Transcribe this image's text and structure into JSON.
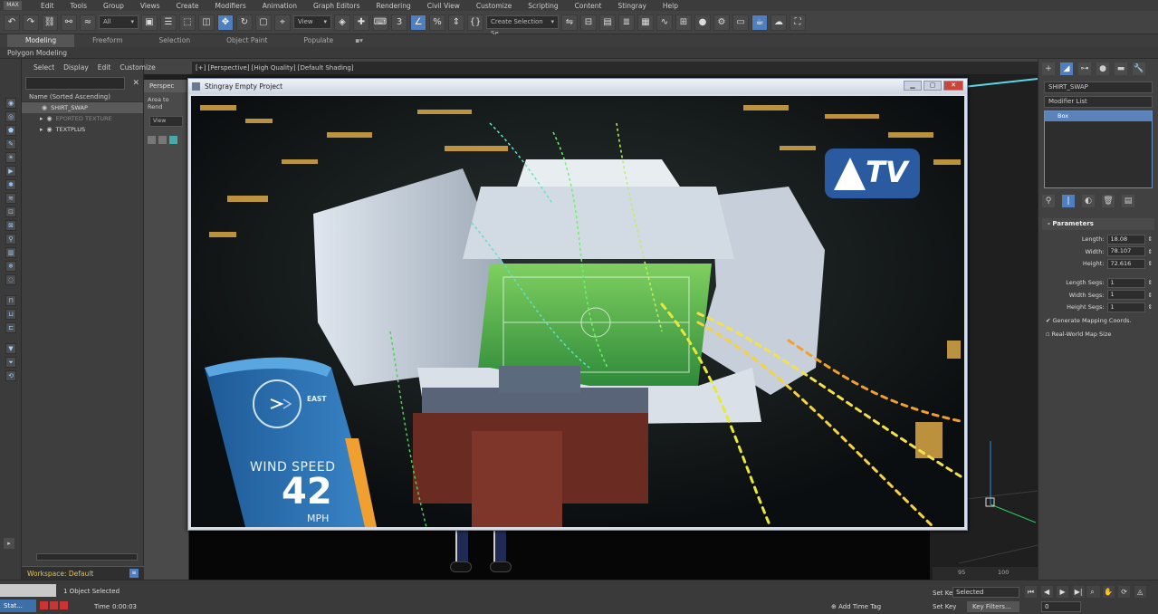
{
  "menu": [
    "Edit",
    "Tools",
    "Group",
    "Views",
    "Create",
    "Modifiers",
    "Animation",
    "Graph Editors",
    "Rendering",
    "Civil View",
    "Customize",
    "Scripting",
    "Content",
    "Stingray",
    "Help"
  ],
  "toolbar": {
    "filter_value": "All",
    "view_value": "View",
    "selection_set_placeholder": "Create Selection Se"
  },
  "ribbon": {
    "tabs": [
      "Modeling",
      "Freeform",
      "Selection",
      "Object Paint",
      "Populate"
    ],
    "active": "Modeling",
    "subtitle": "Polygon Modeling"
  },
  "explorer": {
    "menu": [
      "Select",
      "Display",
      "Edit",
      "Customize"
    ],
    "column_header": "Name (Sorted Ascending)",
    "items": [
      {
        "label": "SHIRT_SWAP"
      },
      {
        "label": "EPORTED TEXTURE"
      },
      {
        "label": "TEXTPLUS"
      }
    ],
    "workspace": "Workspace: Default"
  },
  "viewport": {
    "label": "[+] [Perspective] [High Quality] [Default Shading]"
  },
  "perspective_panel": {
    "title": "Perspec",
    "area": "Area to Rend",
    "view": "View"
  },
  "stingray": {
    "title": "Stingray Empty Project",
    "wind_label": "WIND SPEED",
    "wind_value": "42",
    "wind_unit": "MPH",
    "direction": "EAST",
    "brand_mark": "TV"
  },
  "command_panel": {
    "object_name": "SHIRT_SWAP",
    "modifier_list": "Modifier List",
    "modifier_item": "Box",
    "params_title": "Parameters",
    "length_label": "Length:",
    "length": "18.08",
    "width_label": "Width:",
    "width": "78.107",
    "height_label": "Height:",
    "height": "72.616",
    "length_segs_label": "Length Segs:",
    "length_segs": "1",
    "width_segs_label": "Width Segs:",
    "width_segs": "1",
    "height_segs_label": "Height Segs:",
    "height_segs": "1",
    "gen_mapping": "Generate Mapping Coords.",
    "real_world": "Real-World Map Size"
  },
  "status": {
    "selected_text": "1 Object Selected",
    "time_label": "Time",
    "time_value": "0:00:03",
    "task": "Stat...",
    "add_time_tag": "Add Time Tag",
    "set_key": "Set Key",
    "key_mode": "Selected",
    "key_filters": "Key Filters...",
    "frame": "0",
    "tick_95": "95",
    "tick_100": "100"
  },
  "colors": {
    "accent": "#4f7fbf",
    "stingray_red": "#c9463d",
    "wind_blue": "#2a6ea8",
    "wind_orange": "#f0a030"
  }
}
